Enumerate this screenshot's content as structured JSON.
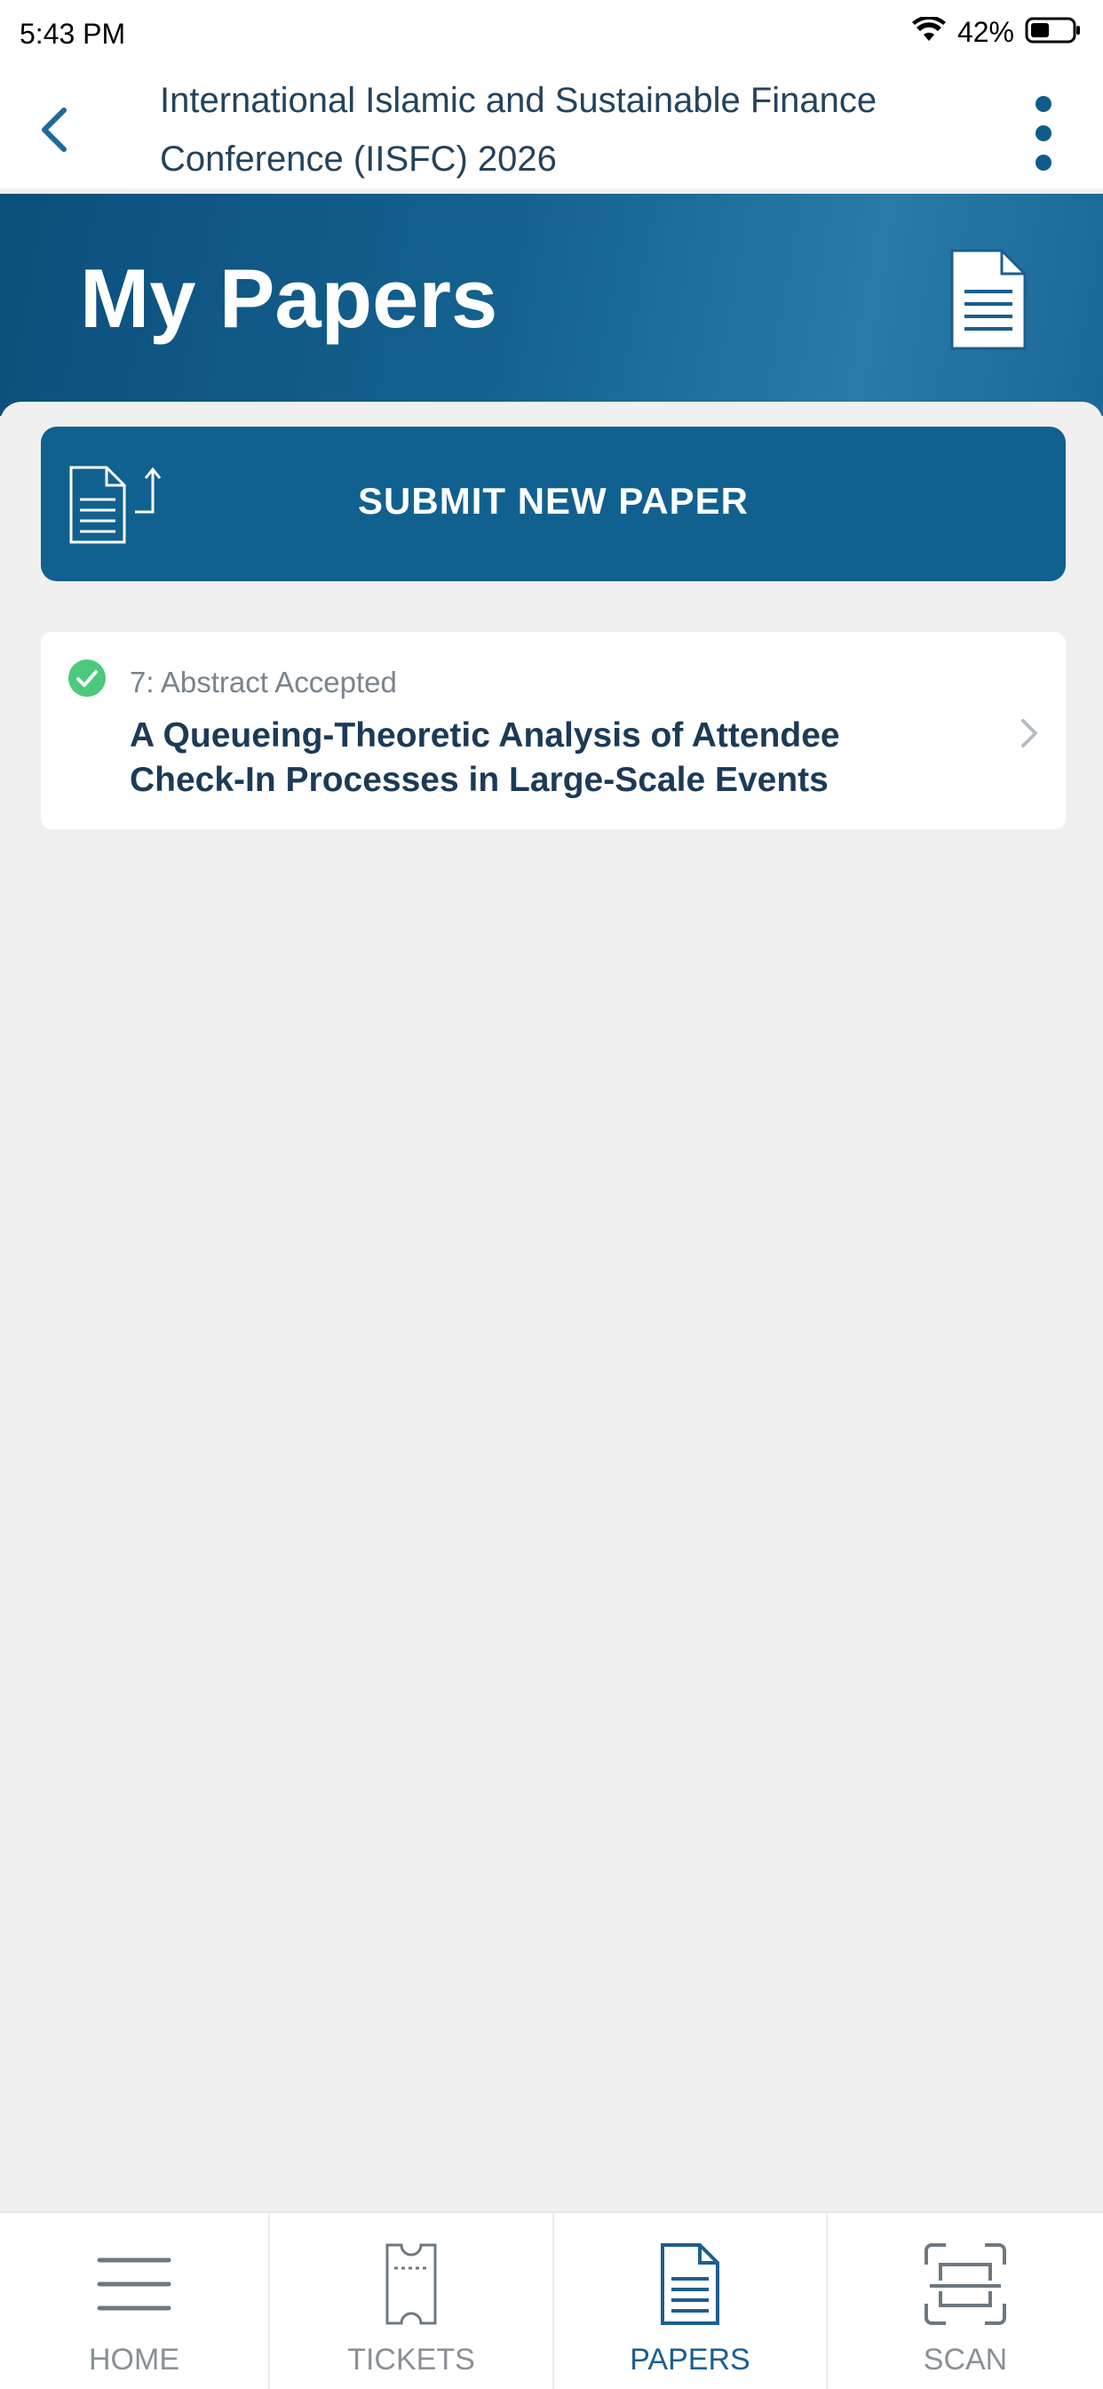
{
  "status_bar": {
    "time": "5:43 PM",
    "battery": "42%"
  },
  "header": {
    "title_line1": "International Islamic and Sustainable Finance",
    "title_line2": "Conference (IISFC) 2026"
  },
  "banner": {
    "title": "My Papers"
  },
  "submit_button": {
    "label": "SUBMIT NEW PAPER"
  },
  "papers": [
    {
      "status": "7: Abstract Accepted",
      "title": "A Queueing-Theoretic Analysis of Attendee Check-In Processes in Large-Scale Events"
    }
  ],
  "tabs": [
    {
      "label": "HOME",
      "icon": "menu-icon",
      "active": false
    },
    {
      "label": "TICKETS",
      "icon": "ticket-icon",
      "active": false
    },
    {
      "label": "PAPERS",
      "icon": "document-icon",
      "active": true
    },
    {
      "label": "SCAN",
      "icon": "scan-icon",
      "active": false
    }
  ],
  "colors": {
    "brand": "#10618f",
    "accent_dark": "#0c4f7d",
    "success": "#4cc97a",
    "background": "#f0f0f0"
  }
}
